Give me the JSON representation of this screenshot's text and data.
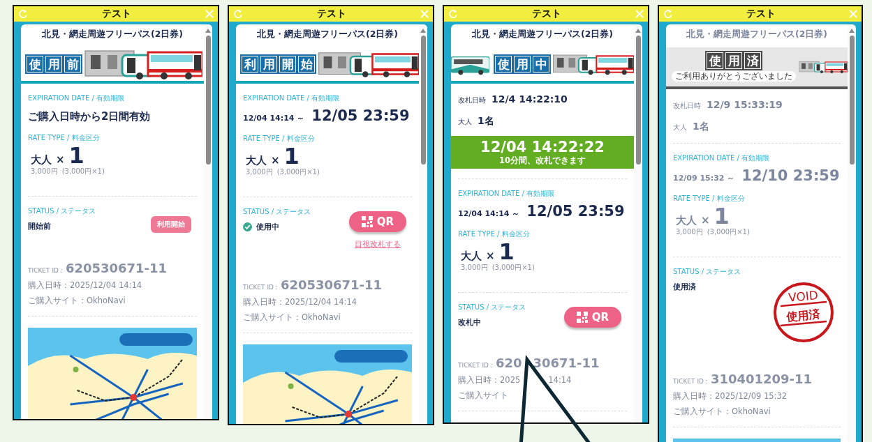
{
  "panels": [
    {
      "title": "テスト",
      "pass_name": "北見・網走周遊フリーパス(2日券)",
      "banner": {
        "label": "使用前",
        "kind": "active"
      },
      "expiration": {
        "label": "EXPIRATION DATE / 有効期限",
        "text": "ご購入日時から2日間有効"
      },
      "rate": {
        "label": "RATE TYPE / 料金区分",
        "fare": "大人",
        "times": "×",
        "count": "1",
        "price": "3,000円",
        "breakdown": "(3,000円×1)"
      },
      "status": {
        "label": "STATUS / ステータス",
        "value": "開始前",
        "checked": false,
        "action": {
          "kind": "start",
          "label": "利用開始"
        }
      },
      "ticket": {
        "id_label": "TICKET ID :",
        "id": [
          "620530671-11"
        ],
        "purchased": [
          "購入日時：2025/12/04 14:14"
        ],
        "site": [
          "ご購入サイト：OkhoNavi"
        ]
      }
    },
    {
      "title": "テスト",
      "pass_name": "北見・網走周遊フリーパス(2日券)",
      "banner": {
        "label": "利用開始",
        "kind": "active"
      },
      "expiration": {
        "label": "EXPIRATION DATE / 有効期限",
        "from": "12/04 14:14 ～",
        "to": "12/05 23:59"
      },
      "rate": {
        "label": "RATE TYPE / 料金区分",
        "fare": "大人",
        "times": "×",
        "count": "1",
        "price": "3,000円",
        "breakdown": "(3,000円×1)"
      },
      "status": {
        "label": "STATUS / ステータス",
        "value": "使用中",
        "checked": true,
        "action": {
          "kind": "qr",
          "label": "QR"
        },
        "link": "目視改札する"
      },
      "ticket": {
        "id_label": "TICKET ID :",
        "id": [
          "620530671-11"
        ],
        "purchased": [
          "購入日時：2025/12/04 14:14"
        ],
        "site": [
          "ご購入サイト：OkhoNavi"
        ]
      }
    },
    {
      "title": "テスト",
      "pass_name": "北見・網走周遊フリーパス(2日券)",
      "banner": {
        "label": "使用中",
        "kind": "in-use"
      },
      "gate": {
        "label": "改札日時",
        "time": "12/4 14:22:10",
        "fare": "大人",
        "count": "1名"
      },
      "timer": {
        "time": "12/04 14:22:22",
        "note": "10分間、改札できます"
      },
      "expiration": {
        "label": "EXPIRATION DATE / 有効期限",
        "from": "12/04 14:14 ～",
        "to": "12/05 23:59"
      },
      "rate": {
        "label": "RATE TYPE / 料金区分",
        "fare": "大人",
        "times": "×",
        "count": "1",
        "price": "3,000円",
        "breakdown": "(3,000円×1)"
      },
      "status": {
        "label": "STATUS / ステータス",
        "value": "改札中",
        "checked": false,
        "action": {
          "kind": "qr",
          "label": "QR"
        }
      },
      "ticket": {
        "id_label": "TICKET ID :",
        "id": [
          "620",
          "30671-11"
        ],
        "purchased": [
          "購入日時：2025",
          "14:14"
        ],
        "site": [
          "ご購入サイト"
        ]
      }
    },
    {
      "title": "テスト",
      "pass_name": "北見・網走周遊フリーパス(2日券)",
      "banner": {
        "label": "使用済",
        "kind": "used",
        "subtitle": "ご利用ありがとうございました"
      },
      "gate": {
        "label": "改札日時",
        "time": "12/9 15:33:19",
        "fare": "大人",
        "count": "1名"
      },
      "expiration": {
        "label": "EXPIRATION DATE / 有効期限",
        "from": "12/09 15:32 ～",
        "to": "12/10 23:59"
      },
      "rate": {
        "label": "RATE TYPE / 料金区分",
        "fare": "大人",
        "times": "×",
        "count": "1",
        "price": "3,000円",
        "breakdown": "(3,000円×1)"
      },
      "status": {
        "label": "STATUS / ステータス",
        "value": "使用済",
        "checked": false,
        "stamp": {
          "top": "VOID",
          "bottom": "使用済"
        }
      },
      "ticket": {
        "id_label": "TICKET ID :",
        "id": [
          "310401209-11"
        ],
        "purchased": [
          "購入日時：2025/12/09 15:32"
        ],
        "site": [
          "ご購入サイト：OkhoNavi"
        ]
      }
    }
  ]
}
